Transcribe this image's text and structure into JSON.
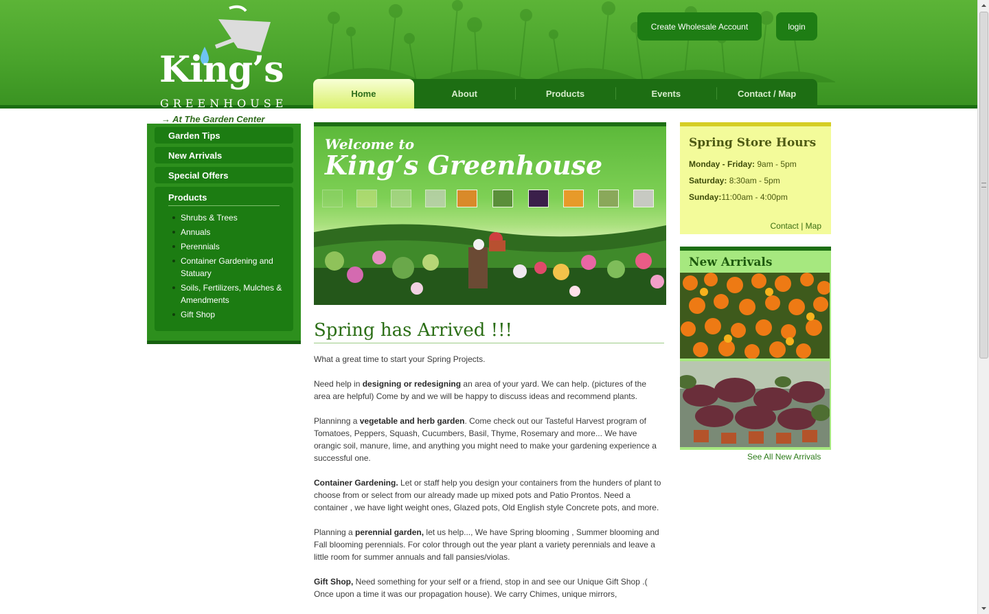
{
  "header": {
    "logo_title": "King’s",
    "logo_subtitle": "GREENHOUSE",
    "logo_tagline": "→ At The Garden Center",
    "wholesale_button": "Create Wholesale Account",
    "login_button": "login"
  },
  "nav": {
    "items": [
      "Home",
      "About",
      "Products",
      "Events",
      "Contact / Map"
    ],
    "active": "Home"
  },
  "sidebar": {
    "links": [
      "Garden Tips",
      "New Arrivals",
      "Special Offers"
    ],
    "products_title": "Products",
    "products": [
      "Shrubs & Trees",
      "Annuals",
      "Perennials",
      "Container Gardening and Statuary",
      "Soils, Fertilizers, Mulches & Amendments",
      "Gift Shop"
    ]
  },
  "hero": {
    "welcome": "Welcome to",
    "name": "King’s Greenhouse"
  },
  "article": {
    "title": "Spring has Arrived !!!",
    "p1": "What a great time to start your Spring Projects.",
    "p2_pre": "Need help in ",
    "p2_bold": "designing or redesigning",
    "p2_post": "  an area of your yard.  We can help.  (pictures of the area are helpful) Come by and we will be happy to discuss ideas and recommend plants.",
    "p3_pre": "Planninng a ",
    "p3_bold": "vegetable and herb garden",
    "p3_post": ".  Come check out our Tasteful Harvest program of Tomatoes, Peppers, Squash, Cucumbers, Basil, Thyme, Rosemary and more...  We have orangic soil, manure, lime, and anything you might need to make your gardening experience a successful one.",
    "p4_bold": "Container Gardening.",
    "p4_post": "   Let or staff help you design your containers from the hunders of plant to choose from or select from our already made up mixed pots and Patio Prontos.  Need a container , we have light weight ones, Glazed pots, Old English style Concrete pots, and more.",
    "p5_pre": "Planning a ",
    "p5_bold": "perennial garden,",
    "p5_post": " let us help..., We have Spring blooming , Summer blooming and Fall blooming perennials. For color through out the year plant a variety perennials  and leave  a little room for summer annuals and fall pansies/violas.",
    "p6_bold": "Gift Shop,",
    "p6_post": "  Need something for your self or a friend, stop in and see our Unique Gift Shop .( Once upon a time it was our propagation house).   We carry Chimes, unique mirrors,"
  },
  "hours": {
    "title": "Spring Store Hours",
    "rows": [
      {
        "day": "Monday - Friday:",
        "time": " 9am - 5pm"
      },
      {
        "day": "Saturday:",
        "time": " 8:30am - 5pm"
      },
      {
        "day": "Sunday:",
        "time": "11:00am - 4:00pm"
      }
    ],
    "contact_link": "Contact",
    "separator": " | ",
    "map_link": "Map"
  },
  "arrivals": {
    "title": "New Arrivals",
    "see_all": "See All New Arrivals"
  },
  "colors": {
    "header_green": "#4aa42c",
    "nav_dark_green": "#1d6e13",
    "active_tab": "#d9f06a",
    "hours_bg": "#f3fb9a",
    "arrivals_bg": "#a6e87f",
    "title_green": "#2b6e16"
  }
}
